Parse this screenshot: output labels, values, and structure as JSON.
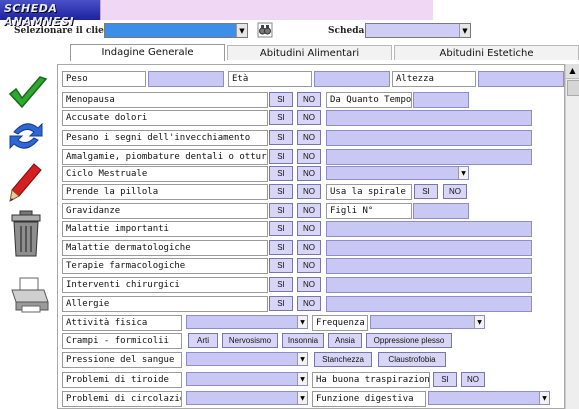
{
  "window": {
    "title": "SCHEDA ANAMNESI"
  },
  "selector": {
    "client_label": "Selezionare il cliente:",
    "client_value": "",
    "scheda_label": "Scheda :",
    "scheda_value": ""
  },
  "tabs": [
    {
      "label": "Indagine Generale"
    },
    {
      "label": "Abitudini Alimentari"
    },
    {
      "label": "Abitudini Estetiche"
    }
  ],
  "form": {
    "peso": "Peso",
    "eta": "Età",
    "altezza": "Altezza",
    "menopausa": "Menopausa",
    "da_quanto_tempo": "Da Quanto Tempo",
    "accusate_dolori": "Accusate dolori",
    "pesano": "Pesano i segni dell'invecchiamento",
    "amalgame": "Amalgamie, piombature dentali o otturazioni",
    "ciclo": "Ciclo Mestruale",
    "pillola": "Prende la pillola",
    "spirale": "Usa la spirale",
    "gravidanze": "Gravidanze",
    "figli": "Figli N°",
    "malattie_importanti": "Malattie importanti",
    "malattie_dermatologiche": "Malattie dermatologiche",
    "terapie": "Terapie farmacologiche",
    "interventi": "Interventi chirurgici",
    "allergie": "Allergie",
    "attivita": "Attività fisica",
    "frequenza": "Frequenza",
    "crampi": "Crampi - formicolii",
    "arti": "Arti",
    "nervosismo": "Nervosismo",
    "insonnia": "Insonnia",
    "ansia": "Ansia",
    "oppressione": "Oppressione plesso",
    "pressione": "Pressione del sangue",
    "stanchezza": "Stanchezza",
    "claustrofobia": "Claustrofobia",
    "tiroide": "Problemi di tiroide",
    "traspirazione": "Ha buona traspirazione",
    "circolazione": "Problemi di circolazione",
    "funzione_digestiva": "Funzione digestiva",
    "si": "SI",
    "no": "NO"
  },
  "colors": {
    "field": "#c9c7f4",
    "title_bar": "#1c22a0",
    "title_panel": "#f0d8f4",
    "client_combo": "#3c8fe8"
  },
  "toolbar_icons": [
    "checkmark-icon",
    "refresh-icon",
    "pencil-icon",
    "trash-icon",
    "printer-icon"
  ]
}
